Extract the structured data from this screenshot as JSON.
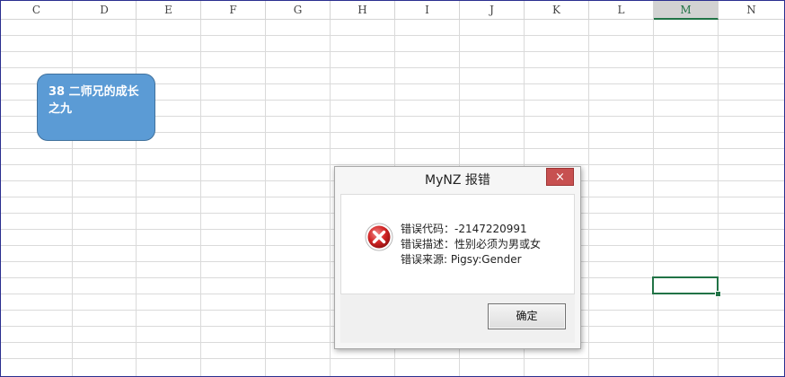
{
  "sheet": {
    "columns": [
      "C",
      "D",
      "E",
      "F",
      "G",
      "H",
      "I",
      "J",
      "K",
      "L",
      "M",
      "N"
    ],
    "selected_column": "M",
    "shape_text": "38  二师兄的成长之九"
  },
  "dialog": {
    "title": "MyNZ 报错",
    "close_label": "×",
    "error_code": "错误代码：-2147220991",
    "error_desc": "错误描述：性别必须为男或女",
    "error_source": "错误来源: Pigsy:Gender",
    "ok_label": "确定"
  }
}
